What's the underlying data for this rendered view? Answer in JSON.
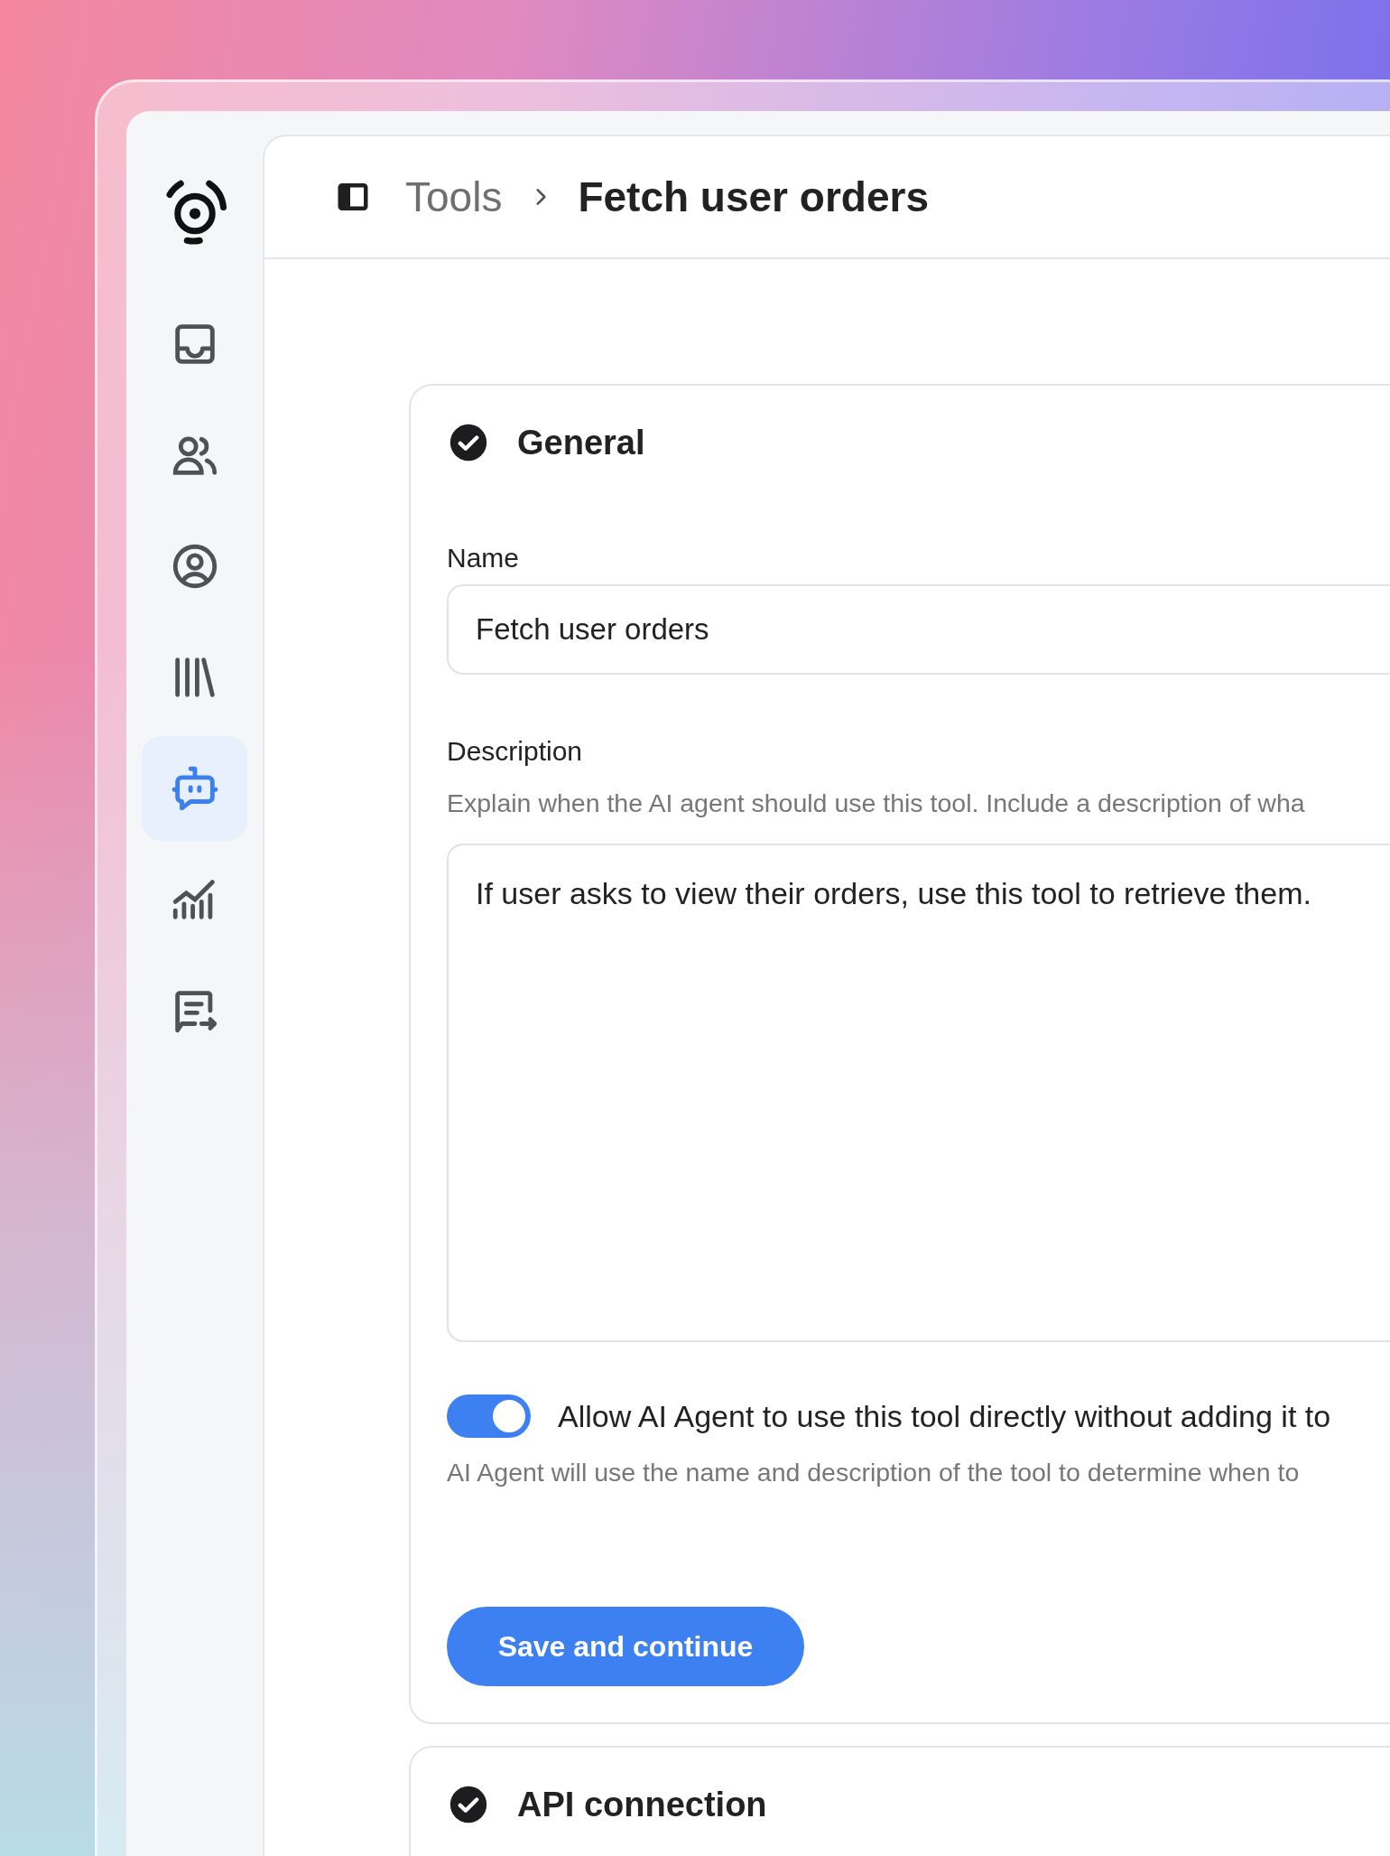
{
  "sidebar": {
    "items": [
      {
        "selected": false
      },
      {
        "selected": false
      },
      {
        "selected": false
      },
      {
        "selected": false
      },
      {
        "selected": true
      },
      {
        "selected": false
      },
      {
        "selected": false
      }
    ]
  },
  "breadcrumb": {
    "parent": "Tools",
    "current": "Fetch user orders"
  },
  "general": {
    "title": "General",
    "completed": true,
    "name_field": {
      "label": "Name",
      "value": "Fetch user orders"
    },
    "description_field": {
      "label": "Description",
      "help": "Explain when the AI agent should use this tool. Include a description of wha",
      "value": "If user asks to view their orders, use this tool to retrieve them."
    },
    "toggle": {
      "label": "Allow AI Agent to use this tool directly without adding it to",
      "on": true,
      "hint": "AI Agent will use the name and description of the tool to determine when to"
    },
    "button": "Save and continue"
  },
  "api_connection": {
    "title": "API connection",
    "completed": true
  }
}
